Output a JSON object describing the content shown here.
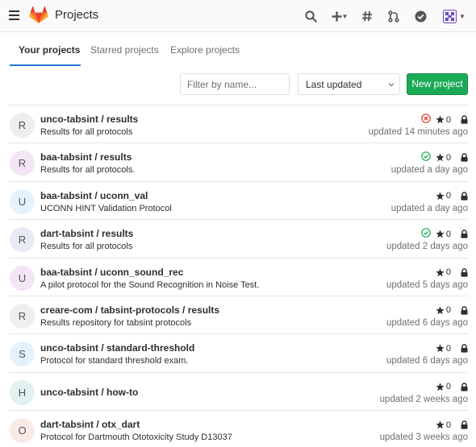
{
  "header": {
    "title": "Projects",
    "icons": [
      "hamburger-icon",
      "gitlab-logo",
      "search-icon",
      "plus-icon",
      "hash-icon",
      "merge-request-icon",
      "todo-check-icon",
      "user-avatar"
    ],
    "accent_color": "#1f78d1"
  },
  "tabs": [
    {
      "label": "Your projects",
      "active": true
    },
    {
      "label": "Starred projects",
      "active": false
    },
    {
      "label": "Explore projects",
      "active": false
    }
  ],
  "controls": {
    "filter_placeholder": "Filter by name...",
    "filter_value": "",
    "sort_selected": "Last updated",
    "new_project_label": "New project",
    "new_project_color": "#1aaa55"
  },
  "projects": [
    {
      "initial": "R",
      "name": "unco-tabsint / results",
      "description": "Results for all protocols",
      "stars": "0",
      "updated": "updated 14 minutes ago",
      "pipeline": "failed",
      "avatar_color": "#eeeeee"
    },
    {
      "initial": "R",
      "name": "baa-tabsint / results",
      "description": "Results for all protocols.",
      "stars": "0",
      "updated": "updated a day ago",
      "pipeline": "passed",
      "avatar_color": "#f3e5f5"
    },
    {
      "initial": "U",
      "name": "baa-tabsint / uconn_val",
      "description": "UCONN HINT Validation Protocol",
      "stars": "0",
      "updated": "updated a day ago",
      "pipeline": "none",
      "avatar_color": "#e3f2fd"
    },
    {
      "initial": "R",
      "name": "dart-tabsint / results",
      "description": "Results for all protocols",
      "stars": "0",
      "updated": "updated 2 days ago",
      "pipeline": "passed",
      "avatar_color": "#e8eaf6"
    },
    {
      "initial": "U",
      "name": "baa-tabsint / uconn_sound_rec",
      "description": "A pilot protocol for the Sound Recognition in Noise Test.",
      "stars": "0",
      "updated": "updated 5 days ago",
      "pipeline": "none",
      "avatar_color": "#f3e5f5"
    },
    {
      "initial": "R",
      "name": "creare-com / tabsint-protocols / results",
      "description": "Results repository for tabsint protocols",
      "stars": "0",
      "updated": "updated 6 days ago",
      "pipeline": "none",
      "avatar_color": "#eeeeee"
    },
    {
      "initial": "S",
      "name": "unco-tabsint / standard-threshold",
      "description": "Protocol for standard threshold exam.",
      "stars": "0",
      "updated": "updated 6 days ago",
      "pipeline": "none",
      "avatar_color": "#e3f2fd"
    },
    {
      "initial": "H",
      "name": "unco-tabsint / how-to",
      "description": "",
      "stars": "0",
      "updated": "updated 2 weeks ago",
      "pipeline": "none",
      "avatar_color": "#e0f2f1"
    },
    {
      "initial": "O",
      "name": "dart-tabsint / otx_dart",
      "description": "Protocol for Dartmouth Ototoxicity Study D13037",
      "stars": "0",
      "updated": "updated 3 weeks ago",
      "pipeline": "none",
      "avatar_color": "#fbe9e7"
    }
  ],
  "status_colors": {
    "failed": "#db3b21",
    "passed": "#1aaa55"
  }
}
